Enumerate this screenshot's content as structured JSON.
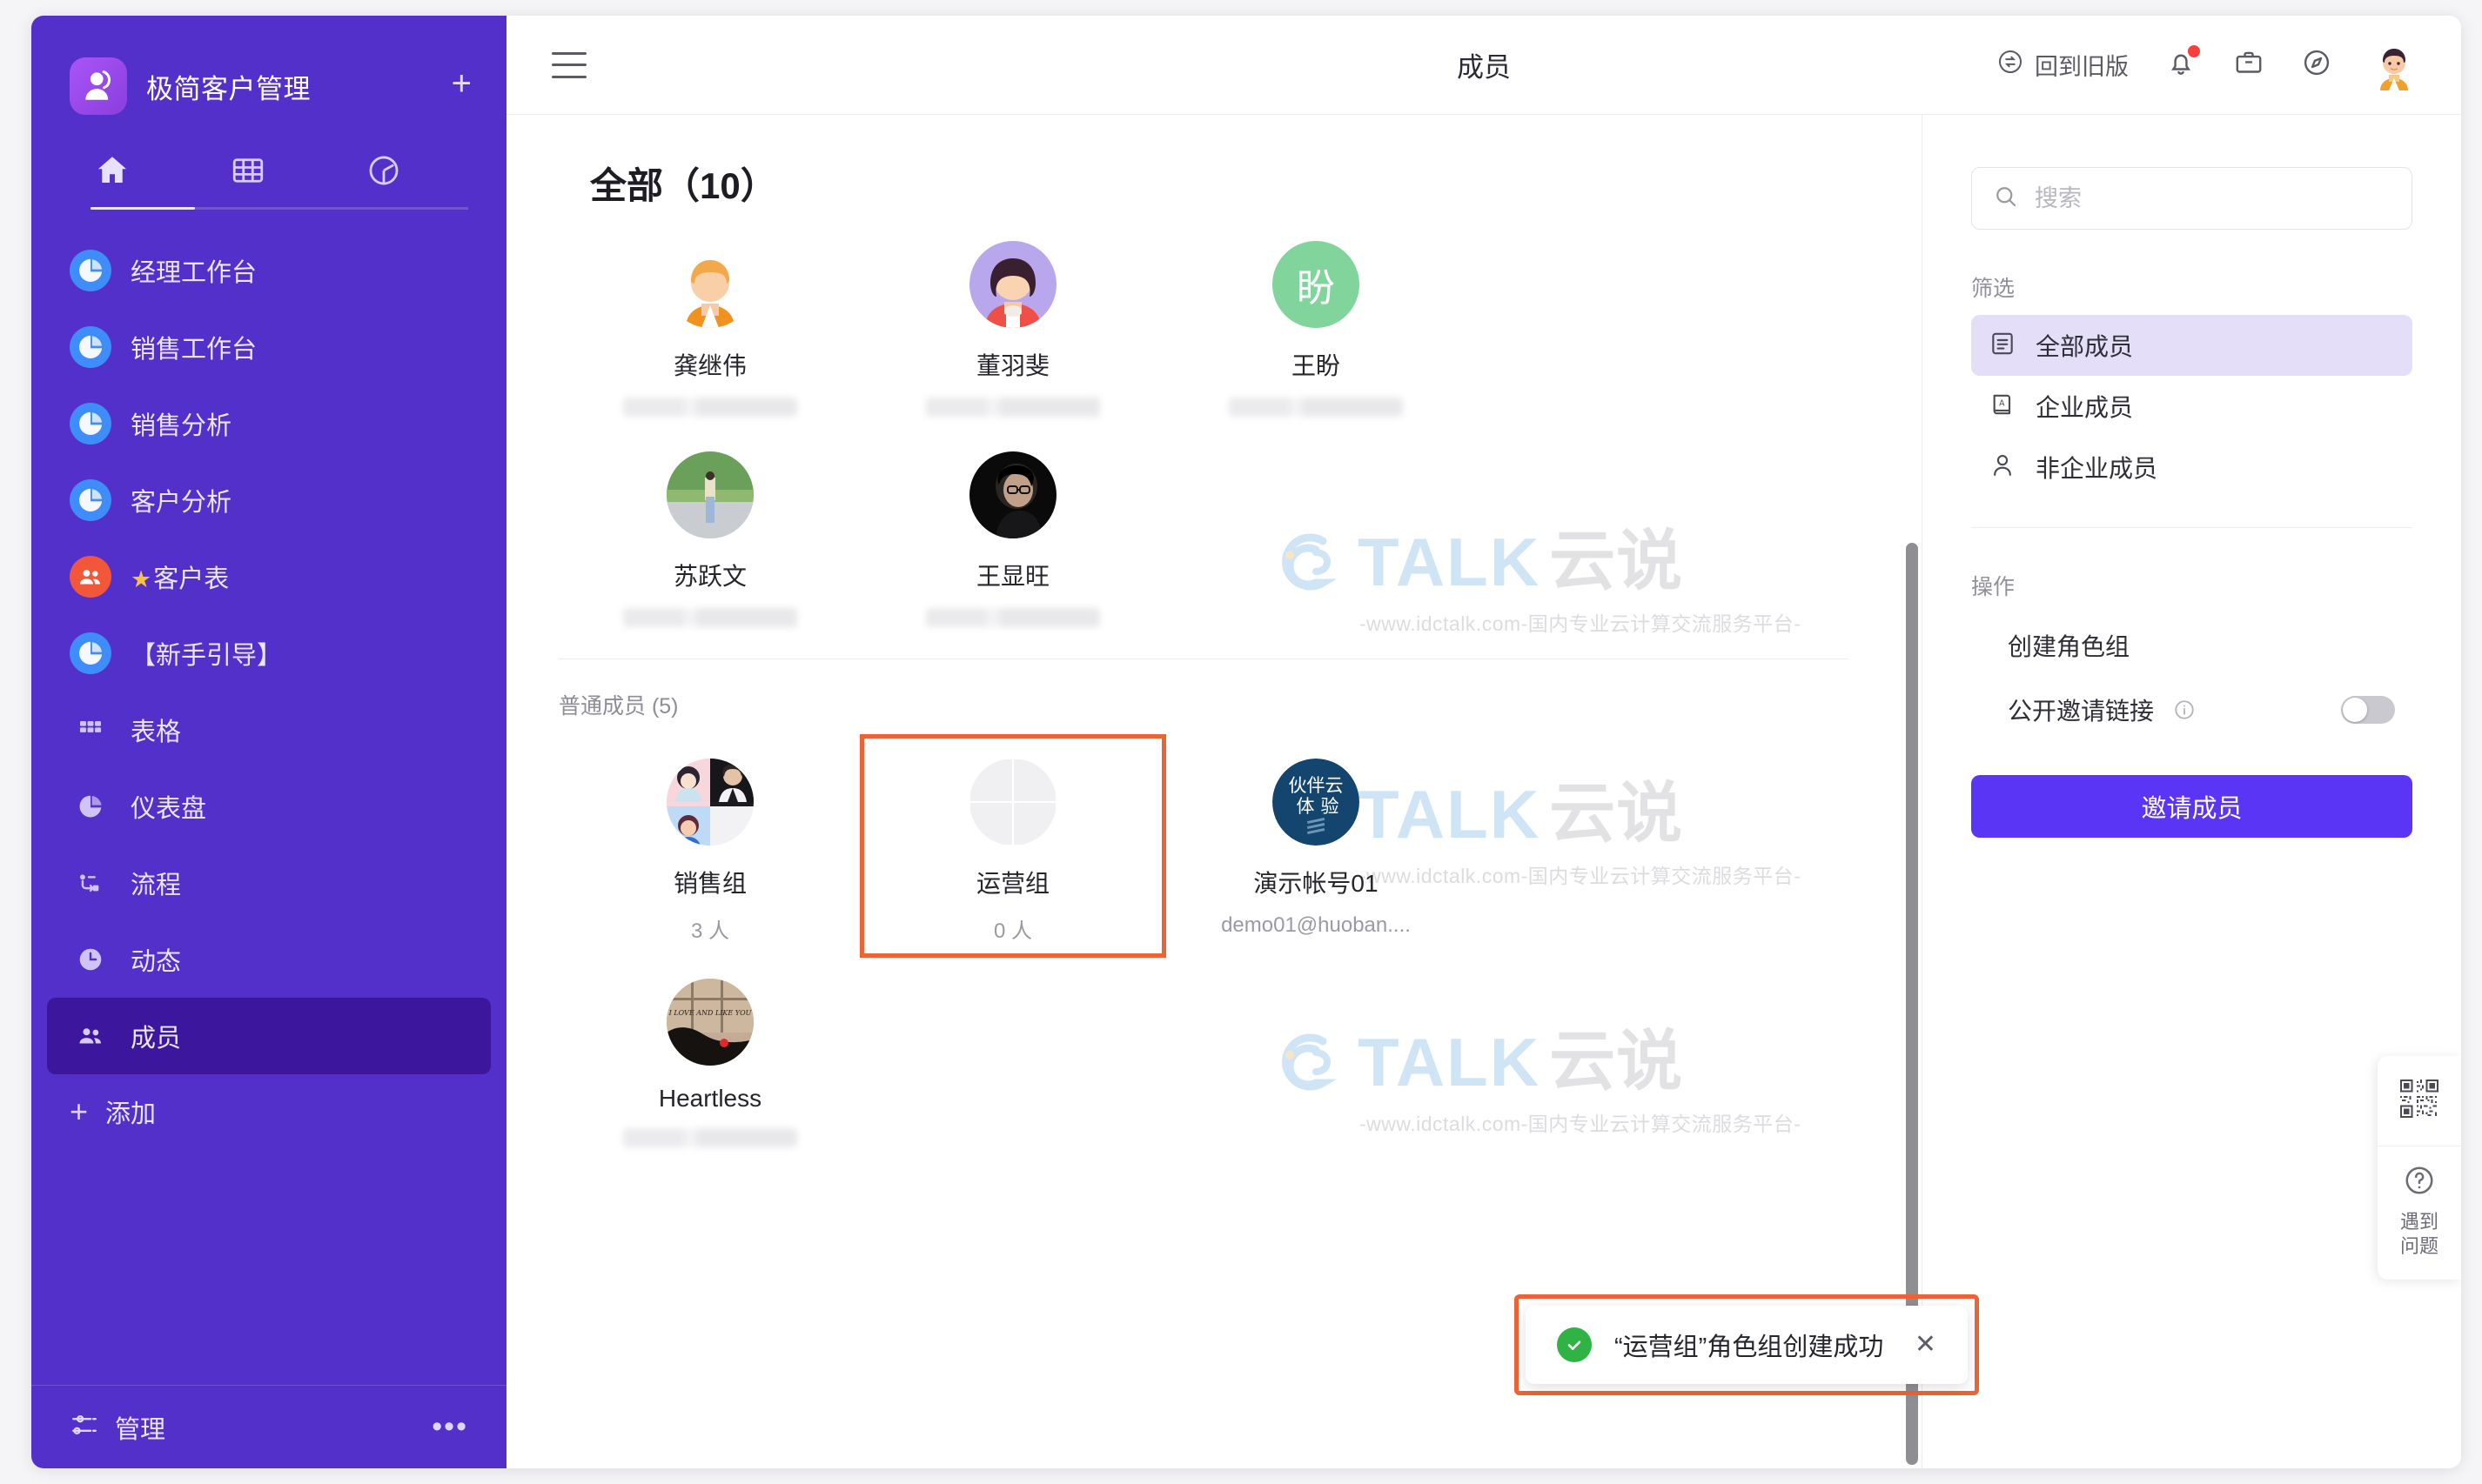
{
  "app": {
    "brand": "极简客户管理",
    "add_board_icon": "plus-icon"
  },
  "sidebar": {
    "tabs": [
      {
        "name": "home-tab",
        "icon": "home-icon",
        "active": true
      },
      {
        "name": "table-tab",
        "icon": "grid-icon",
        "active": false
      },
      {
        "name": "chart-tab",
        "icon": "pie-chart-icon",
        "active": false
      }
    ],
    "items": [
      {
        "label": "经理工作台",
        "icon": "pie-chart-icon",
        "style": "blue",
        "active": false
      },
      {
        "label": "销售工作台",
        "icon": "pie-chart-icon",
        "style": "blue",
        "active": false
      },
      {
        "label": "销售分析",
        "icon": "pie-chart-icon",
        "style": "blue",
        "active": false
      },
      {
        "label": "客户分析",
        "icon": "pie-chart-icon",
        "style": "blue",
        "active": false
      },
      {
        "label": "客户表",
        "icon": "people-icon",
        "style": "red",
        "prefix": "★",
        "active": false
      },
      {
        "label": "【新手引导】",
        "icon": "pie-chart-icon",
        "style": "blue",
        "active": false
      },
      {
        "label": "表格",
        "icon": "grid-icon",
        "style": "plain",
        "active": false
      },
      {
        "label": "仪表盘",
        "icon": "pie-chart-icon",
        "style": "plain",
        "active": false
      },
      {
        "label": "流程",
        "icon": "flow-icon",
        "style": "plain",
        "active": false
      },
      {
        "label": "动态",
        "icon": "clock-icon",
        "style": "plain",
        "active": false
      },
      {
        "label": "成员",
        "icon": "members-icon",
        "style": "plain",
        "active": true
      }
    ],
    "add_label": "添加",
    "footer": {
      "label": "管理",
      "icon": "sliders-icon",
      "more_icon": "more-dots-icon"
    }
  },
  "topbar": {
    "menu_icon": "hamburger-icon",
    "title": "成员",
    "old_version_label": "回到旧版",
    "old_version_icon": "swap-circle-icon",
    "bell_icon": "bell-icon",
    "briefcase_icon": "briefcase-icon",
    "compass_icon": "compass-icon",
    "avatar": "user-avatar"
  },
  "content": {
    "page_title": "全部（10）",
    "all_members": [
      {
        "name": "龚继伟",
        "sub": "",
        "avatar": "illustration-orange",
        "blurred_sub": true
      },
      {
        "name": "董羽斐",
        "sub": "",
        "avatar": "illustration-purple",
        "blurred_sub": true
      },
      {
        "name": "王盼",
        "sub": "",
        "avatar": "initial-green",
        "initial": "盼",
        "blurred_sub": true
      },
      {
        "name": "苏跃文",
        "sub": "",
        "avatar": "photo-outdoor",
        "blurred_sub": true
      },
      {
        "name": "王显旺",
        "sub": "",
        "avatar": "photo-dark",
        "blurred_sub": true
      }
    ],
    "section_title": "普通成员 (5)",
    "normal_members": [
      {
        "name": "销售组",
        "sub": "3 人",
        "avatar": "group-tiles",
        "highlight": false
      },
      {
        "name": "运营组",
        "sub": "0 人",
        "avatar": "empty-tiles",
        "highlight": true
      },
      {
        "name": "演示帐号01",
        "sub": "demo01@huoban....",
        "avatar": "logo-huoban",
        "highlight": false
      },
      {
        "name": "Heartless",
        "sub": "",
        "avatar": "photo-night",
        "blurred_sub": true,
        "highlight": false
      }
    ]
  },
  "right_panel": {
    "search": {
      "placeholder": "搜索",
      "value": "",
      "icon": "search-icon"
    },
    "filter_group_label": "筛选",
    "filters": [
      {
        "label": "全部成员",
        "icon": "list-icon",
        "active": true
      },
      {
        "label": "企业成员",
        "icon": "book-icon",
        "active": false
      },
      {
        "label": "非企业成员",
        "icon": "person-icon",
        "active": false
      }
    ],
    "actions_group_label": "操作",
    "actions": [
      {
        "label": "创建角色组",
        "icon": "plus-circle-icon",
        "type": "link"
      },
      {
        "label": "公开邀请链接",
        "icon": "link-icon",
        "type": "toggle",
        "toggle_on": false,
        "info_icon": "info-icon"
      }
    ],
    "invite_button": "邀请成员"
  },
  "dock": {
    "qr_icon": "qrcode-icon",
    "help_icon": "question-circle-icon",
    "help_label_line1": "遇到",
    "help_label_line2": "问题"
  },
  "toast": {
    "icon": "check-circle-icon",
    "message": "“运营组”角色组创建成功",
    "close_icon": "close-icon"
  },
  "watermark": {
    "brand_talk": "TALK",
    "brand_yun": "云说",
    "url": "-www.idctalk.com-国内专业云计算交流服务平台-"
  },
  "colors": {
    "sidebar_bg": "#5430ca",
    "sidebar_active": "#3d169e",
    "accent": "#5b35f5",
    "filter_active_bg": "#e4def9",
    "highlight_border": "#ec6336",
    "success": "#2fb344",
    "notification_dot": "#fa3d3d"
  }
}
